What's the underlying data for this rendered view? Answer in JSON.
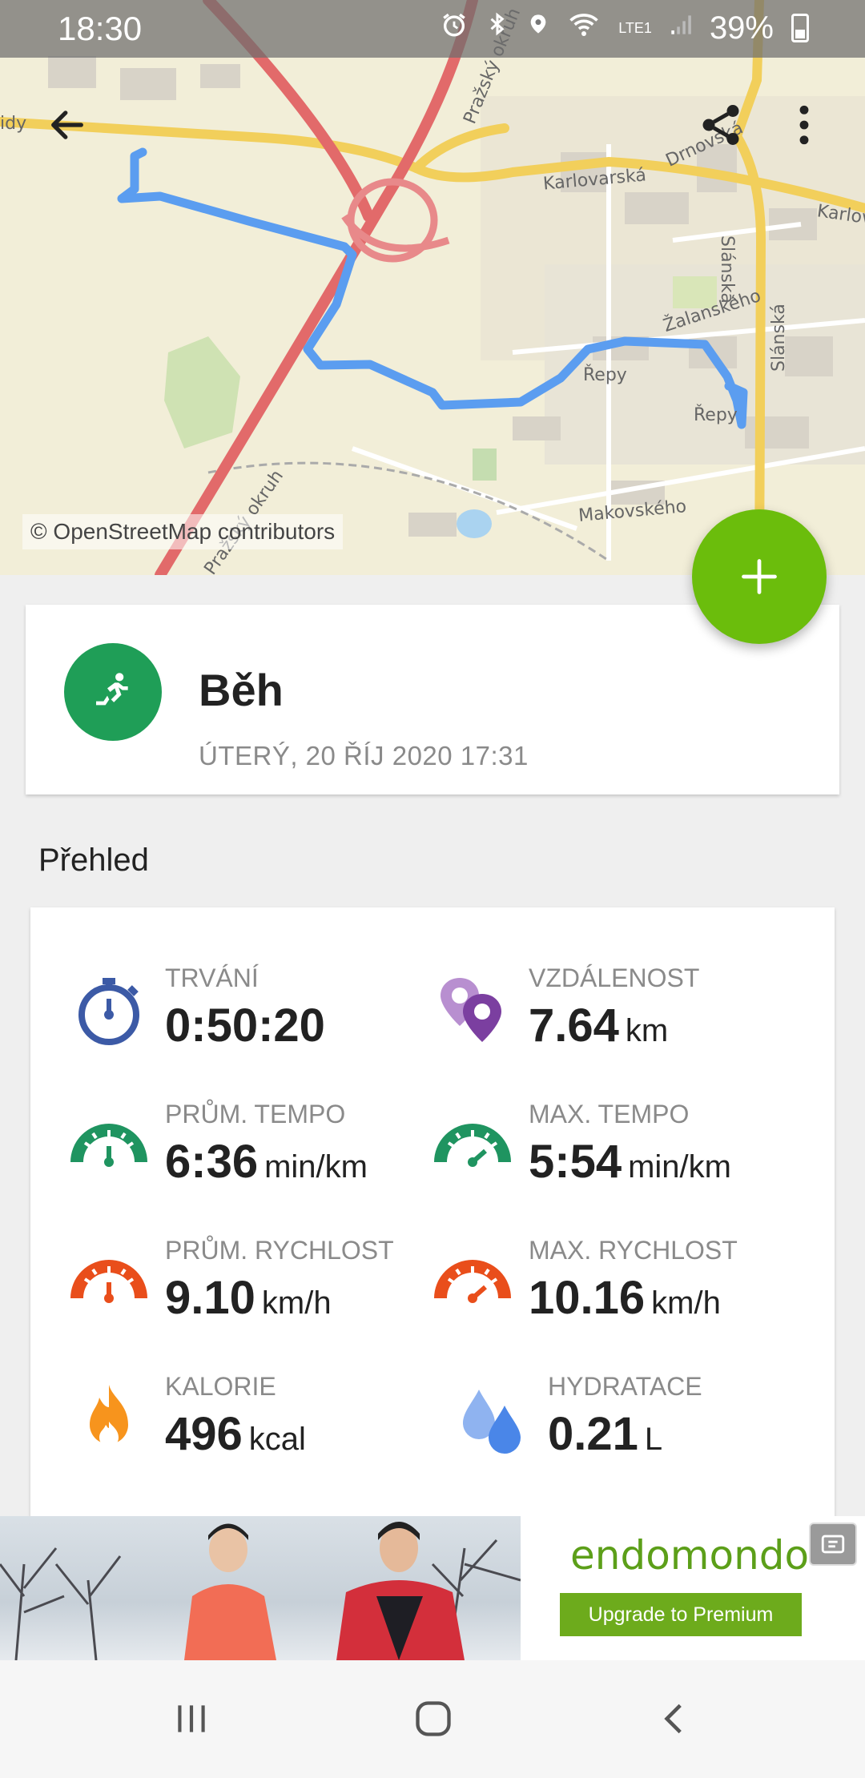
{
  "status_bar": {
    "time": "18:30",
    "battery": "39%",
    "network": "LTE1",
    "icons": [
      "alarm-icon",
      "bluetooth-icon",
      "location-icon",
      "wifi-icon",
      "signal-icon",
      "battery-icon"
    ]
  },
  "map": {
    "attribution": "© OpenStreetMap contributors",
    "labels": [
      "Karlovarská",
      "Karlov",
      "Drnovská",
      "Pražský okruh",
      "Žalanského",
      "Řepy",
      "Řepy",
      "Slánská",
      "Slánská",
      "Makovského",
      "Pražský okruh",
      "idy"
    ],
    "route_color": "#5b9df0"
  },
  "header": {
    "back_icon": "arrow-back-icon",
    "share_icon": "share-icon",
    "menu_icon": "more-vert-icon"
  },
  "fab": {
    "icon": "plus-icon",
    "color": "#6bbd0c"
  },
  "workout": {
    "sport": "Běh",
    "date": "ÚTERÝ, 20 ŘÍJ 2020 17:31",
    "icon": "running-icon",
    "icon_color": "#1f9e57"
  },
  "overview": {
    "title": "Přehled",
    "stats": [
      {
        "label": "TRVÁNÍ",
        "value": "0:50:20",
        "unit": "",
        "icon": "stopwatch-icon"
      },
      {
        "label": "VZDÁLENOST",
        "value": "7.64",
        "unit": "km",
        "icon": "location-pins-icon"
      },
      {
        "label": "PRŮM. TEMPO",
        "value": "6:36",
        "unit": "min/km",
        "icon": "pace-gauge-icon"
      },
      {
        "label": "MAX. TEMPO",
        "value": "5:54",
        "unit": "min/km",
        "icon": "max-pace-gauge-icon"
      },
      {
        "label": "PRŮM. RYCHLOST",
        "value": "9.10",
        "unit": "km/h",
        "icon": "speed-gauge-icon"
      },
      {
        "label": "MAX. RYCHLOST",
        "value": "10.16",
        "unit": "km/h",
        "icon": "max-speed-gauge-icon"
      },
      {
        "label": "KALORIE",
        "value": "496",
        "unit": "kcal",
        "icon": "flame-icon"
      },
      {
        "label": "HYDRATACE",
        "value": "0.21",
        "unit": "L",
        "icon": "water-drops-icon"
      }
    ]
  },
  "ad": {
    "brand": "endomondo",
    "cta": "Upgrade to Premium"
  },
  "navbar": {
    "icons": [
      "recent-apps-icon",
      "home-icon",
      "back-icon"
    ]
  }
}
